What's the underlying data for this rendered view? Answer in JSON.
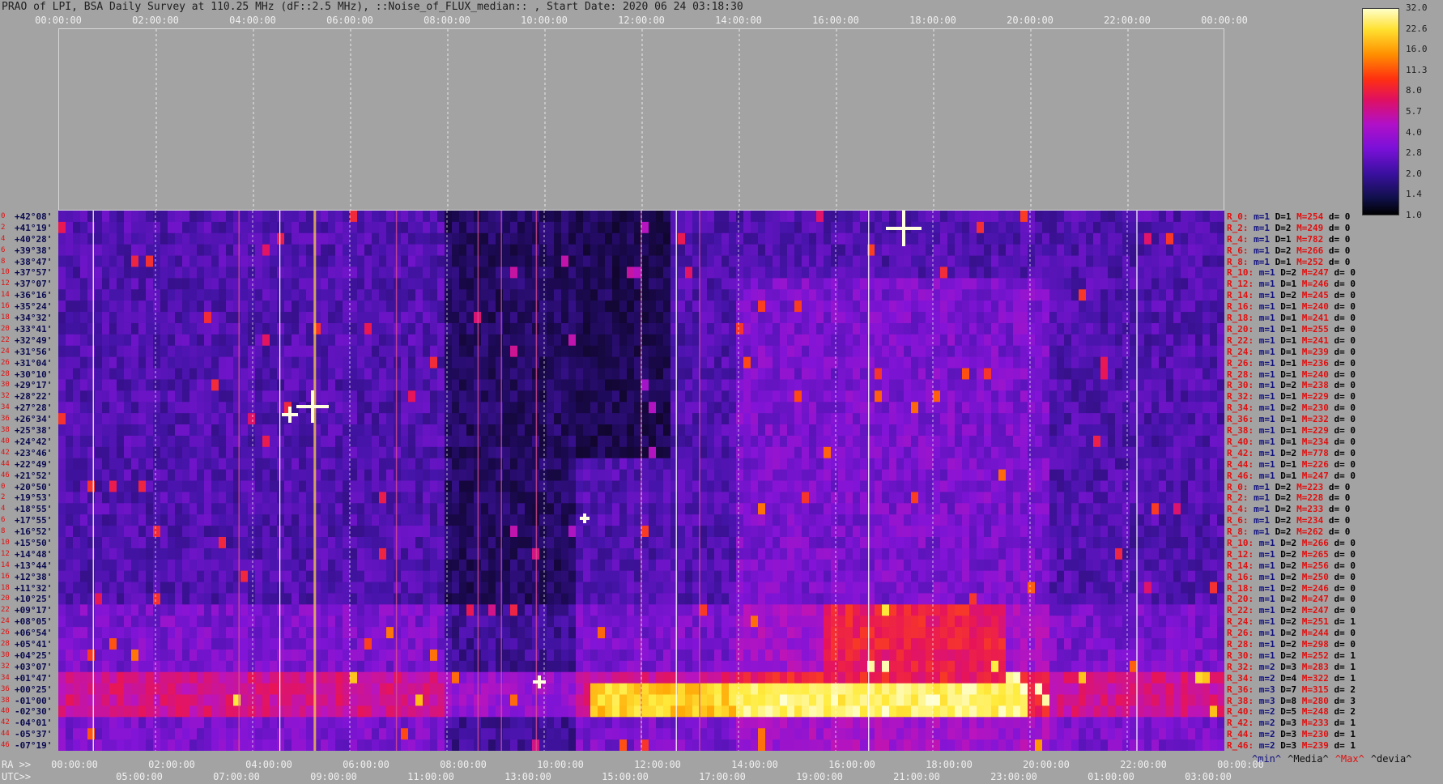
{
  "title": "PRAO of LPI, BSA Daily Survey at 110.25 MHz (dF::2.5 MHz), ::Noise_of_FLUX_median:: , Start Date: 2020 06 24 03:18:30",
  "top_ticks": [
    "00:00:00",
    "02:00:00",
    "04:00:00",
    "06:00:00",
    "08:00:00",
    "10:00:00",
    "12:00:00",
    "14:00:00",
    "16:00:00",
    "18:00:00",
    "20:00:00",
    "22:00:00",
    "00:00:00"
  ],
  "ra_label": "RA >>",
  "ra_ticks": [
    "00:00:00",
    "02:00:00",
    "04:00:00",
    "06:00:00",
    "08:00:00",
    "10:00:00",
    "12:00:00",
    "14:00:00",
    "16:00:00",
    "18:00:00",
    "20:00:00",
    "22:00:00",
    "00:00:00"
  ],
  "utc_label": "UTC>>",
  "utc_ticks": [
    "05:00:00",
    "07:00:00",
    "09:00:00",
    "11:00:00",
    "13:00:00",
    "15:00:00",
    "17:00:00",
    "19:00:00",
    "21:00:00",
    "23:00:00",
    "01:00:00",
    "03:00:00"
  ],
  "colorbar_ticks": [
    "32.0",
    "22.6",
    "16.0",
    "11.3",
    "8.0",
    "5.7",
    "4.0",
    "2.8",
    "2.0",
    "1.4",
    "1.0"
  ],
  "declinations": [
    "+42°08'",
    "+41°19'",
    "+40°28'",
    "+39°38'",
    "+38°47'",
    "+37°57'",
    "+37°07'",
    "+36°16'",
    "+35°24'",
    "+34°32'",
    "+33°41'",
    "+32°49'",
    "+31°56'",
    "+31°04'",
    "+30°10'",
    "+29°17'",
    "+28°22'",
    "+27°28'",
    "+26°34'",
    "+25°38'",
    "+24°42'",
    "+23°46'",
    "+22°49'",
    "+21°52'",
    "+20°50'",
    "+19°53'",
    "+18°55'",
    "+17°55'",
    "+16°52'",
    "+15°50'",
    "+14°48'",
    "+13°44'",
    "+12°38'",
    "+11°32'",
    "+10°25'",
    "+09°17'",
    "+08°05'",
    "+06°54'",
    "+05°41'",
    "+04°25'",
    "+03°07'",
    "+01°47'",
    "+00°25'",
    "-01°00'",
    "-02°30'",
    "-04°01'",
    "-05°37'",
    "-07°19'"
  ],
  "row_numbers": [
    "0",
    "2",
    "4",
    "6",
    "8",
    "10",
    "12",
    "14",
    "16",
    "18",
    "20",
    "22",
    "24",
    "26",
    "28",
    "30",
    "32",
    "34",
    "36",
    "38",
    "40",
    "42",
    "44",
    "46",
    "0",
    "2",
    "4",
    "6",
    "8",
    "10",
    "12",
    "14",
    "16",
    "18",
    "20",
    "22",
    "24",
    "26",
    "28",
    "30",
    "32",
    "34",
    "36",
    "38",
    "40",
    "42",
    "44",
    "46"
  ],
  "stats": [
    {
      "r": "R_0:",
      "m": "m=1",
      "D": "D=1",
      "M": "M=254",
      "d": "d= 0"
    },
    {
      "r": "R_2:",
      "m": "m=1",
      "D": "D=2",
      "M": "M=249",
      "d": "d= 0"
    },
    {
      "r": "R_4:",
      "m": "m=1",
      "D": "D=1",
      "M": "M=782",
      "d": "d= 0"
    },
    {
      "r": "R_6:",
      "m": "m=1",
      "D": "D=2",
      "M": "M=266",
      "d": "d= 0"
    },
    {
      "r": "R_8:",
      "m": "m=1",
      "D": "D=1",
      "M": "M=252",
      "d": "d= 0"
    },
    {
      "r": "R_10:",
      "m": "m=1",
      "D": "D=2",
      "M": "M=247",
      "d": "d= 0"
    },
    {
      "r": "R_12:",
      "m": "m=1",
      "D": "D=1",
      "M": "M=246",
      "d": "d= 0"
    },
    {
      "r": "R_14:",
      "m": "m=1",
      "D": "D=2",
      "M": "M=245",
      "d": "d= 0"
    },
    {
      "r": "R_16:",
      "m": "m=1",
      "D": "D=1",
      "M": "M=240",
      "d": "d= 0"
    },
    {
      "r": "R_18:",
      "m": "m=1",
      "D": "D=1",
      "M": "M=241",
      "d": "d= 0"
    },
    {
      "r": "R_20:",
      "m": "m=1",
      "D": "D=1",
      "M": "M=255",
      "d": "d= 0"
    },
    {
      "r": "R_22:",
      "m": "m=1",
      "D": "D=1",
      "M": "M=241",
      "d": "d= 0"
    },
    {
      "r": "R_24:",
      "m": "m=1",
      "D": "D=1",
      "M": "M=239",
      "d": "d= 0"
    },
    {
      "r": "R_26:",
      "m": "m=1",
      "D": "D=1",
      "M": "M=236",
      "d": "d= 0"
    },
    {
      "r": "R_28:",
      "m": "m=1",
      "D": "D=1",
      "M": "M=240",
      "d": "d= 0"
    },
    {
      "r": "R_30:",
      "m": "m=1",
      "D": "D=2",
      "M": "M=238",
      "d": "d= 0"
    },
    {
      "r": "R_32:",
      "m": "m=1",
      "D": "D=1",
      "M": "M=229",
      "d": "d= 0"
    },
    {
      "r": "R_34:",
      "m": "m=1",
      "D": "D=2",
      "M": "M=230",
      "d": "d= 0"
    },
    {
      "r": "R_36:",
      "m": "m=1",
      "D": "D=1",
      "M": "M=232",
      "d": "d= 0"
    },
    {
      "r": "R_38:",
      "m": "m=1",
      "D": "D=1",
      "M": "M=229",
      "d": "d= 0"
    },
    {
      "r": "R_40:",
      "m": "m=1",
      "D": "D=1",
      "M": "M=234",
      "d": "d= 0"
    },
    {
      "r": "R_42:",
      "m": "m=1",
      "D": "D=2",
      "M": "M=778",
      "d": "d= 0"
    },
    {
      "r": "R_44:",
      "m": "m=1",
      "D": "D=1",
      "M": "M=226",
      "d": "d= 0"
    },
    {
      "r": "R_46:",
      "m": "m=1",
      "D": "D=1",
      "M": "M=247",
      "d": "d= 0"
    },
    {
      "r": "R_0:",
      "m": "m=1",
      "D": "D=2",
      "M": "M=223",
      "d": "d= 0"
    },
    {
      "r": "R_2:",
      "m": "m=1",
      "D": "D=2",
      "M": "M=228",
      "d": "d= 0"
    },
    {
      "r": "R_4:",
      "m": "m=1",
      "D": "D=2",
      "M": "M=233",
      "d": "d= 0"
    },
    {
      "r": "R_6:",
      "m": "m=1",
      "D": "D=2",
      "M": "M=234",
      "d": "d= 0"
    },
    {
      "r": "R_8:",
      "m": "m=1",
      "D": "D=2",
      "M": "M=262",
      "d": "d= 0"
    },
    {
      "r": "R_10:",
      "m": "m=1",
      "D": "D=2",
      "M": "M=266",
      "d": "d= 0"
    },
    {
      "r": "R_12:",
      "m": "m=1",
      "D": "D=2",
      "M": "M=265",
      "d": "d= 0"
    },
    {
      "r": "R_14:",
      "m": "m=1",
      "D": "D=2",
      "M": "M=256",
      "d": "d= 0"
    },
    {
      "r": "R_16:",
      "m": "m=1",
      "D": "D=2",
      "M": "M=250",
      "d": "d= 0"
    },
    {
      "r": "R_18:",
      "m": "m=1",
      "D": "D=2",
      "M": "M=246",
      "d": "d= 0"
    },
    {
      "r": "R_20:",
      "m": "m=1",
      "D": "D=2",
      "M": "M=247",
      "d": "d= 0"
    },
    {
      "r": "R_22:",
      "m": "m=1",
      "D": "D=2",
      "M": "M=247",
      "d": "d= 0"
    },
    {
      "r": "R_24:",
      "m": "m=1",
      "D": "D=2",
      "M": "M=251",
      "d": "d= 1"
    },
    {
      "r": "R_26:",
      "m": "m=1",
      "D": "D=2",
      "M": "M=244",
      "d": "d= 0"
    },
    {
      "r": "R_28:",
      "m": "m=1",
      "D": "D=2",
      "M": "M=298",
      "d": "d= 0"
    },
    {
      "r": "R_30:",
      "m": "m=1",
      "D": "D=2",
      "M": "M=252",
      "d": "d= 1"
    },
    {
      "r": "R_32:",
      "m": "m=2",
      "D": "D=3",
      "M": "M=283",
      "d": "d= 1"
    },
    {
      "r": "R_34:",
      "m": "m=2",
      "D": "D=4",
      "M": "M=322",
      "d": "d= 1"
    },
    {
      "r": "R_36:",
      "m": "m=3",
      "D": "D=7",
      "M": "M=315",
      "d": "d= 2"
    },
    {
      "r": "R_38:",
      "m": "m=3",
      "D": "D=8",
      "M": "M=280",
      "d": "d= 3"
    },
    {
      "r": "R_40:",
      "m": "m=2",
      "D": "D=5",
      "M": "M=248",
      "d": "d= 2"
    },
    {
      "r": "R_42:",
      "m": "m=2",
      "D": "D=3",
      "M": "M=233",
      "d": "d= 1"
    },
    {
      "r": "R_44:",
      "m": "m=2",
      "D": "D=3",
      "M": "M=230",
      "d": "d= 1"
    },
    {
      "r": "R_46:",
      "m": "m=2",
      "D": "D=3",
      "M": "M=239",
      "d": "d= 1"
    }
  ],
  "legend": {
    "min": "^min^",
    "median": "^Media^",
    "max": "^Max^",
    "devia": "^devia^"
  },
  "colors": {
    "background": "#a3a3a3",
    "row_label": "#e01010",
    "decl_label": "#0a0a50",
    "grid": "#e8e8e8"
  },
  "chart_data": {
    "type": "heatmap",
    "title": "PRAO of LPI, BSA Daily Survey at 110.25 MHz (dF::2.5 MHz), ::Noise_of_FLUX_median:: , Start Date: 2020 06 24 03:18:30",
    "xlabel": "RA",
    "x2label": "UTC",
    "ylabel": "",
    "x_range": [
      "00:00:00",
      "00:00:00"
    ],
    "color_scale": "log",
    "color_range": [
      1.0,
      32.0
    ],
    "rows": 48
  }
}
